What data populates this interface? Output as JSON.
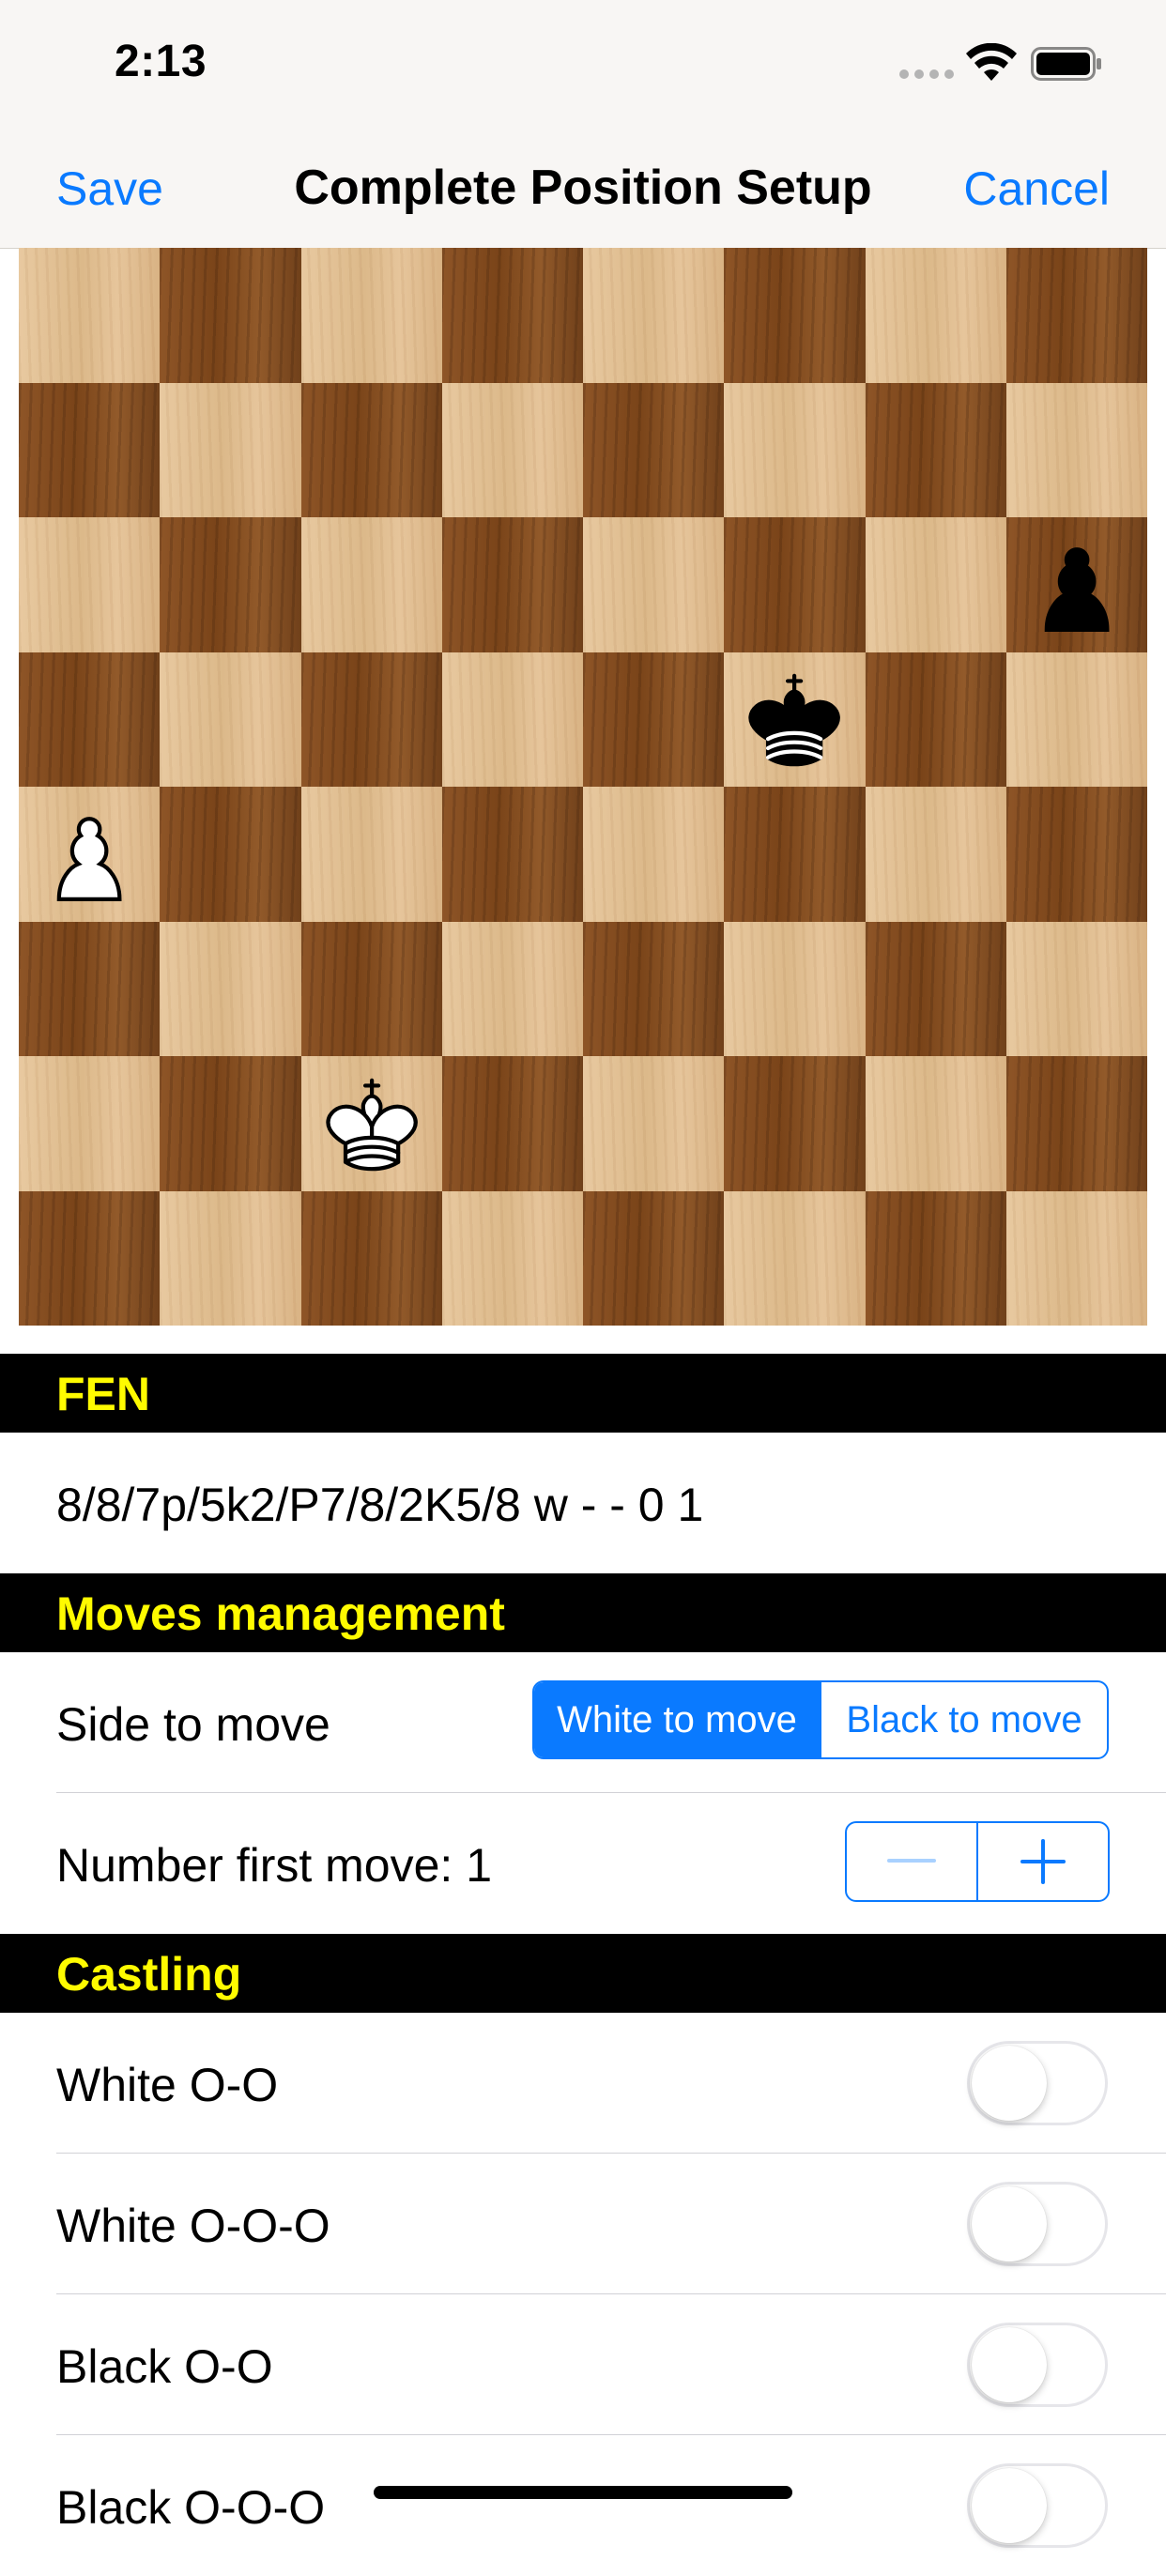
{
  "status_bar": {
    "time": "2:13"
  },
  "nav": {
    "save_label": "Save",
    "title": "Complete Position Setup",
    "cancel_label": "Cancel"
  },
  "board": {
    "pieces": [
      {
        "square": "h6",
        "color": "black",
        "type": "pawn"
      },
      {
        "square": "f5",
        "color": "black",
        "type": "king"
      },
      {
        "square": "a4",
        "color": "white",
        "type": "pawn"
      },
      {
        "square": "c2",
        "color": "white",
        "type": "king"
      }
    ]
  },
  "fen_section": {
    "header": "FEN",
    "value": "8/8/7p/5k2/P7/8/2K5/8 w - - 0 1"
  },
  "moves_section": {
    "header": "Moves management",
    "side_to_move_label": "Side to move",
    "side_options": [
      "White to move",
      "Black to move"
    ],
    "side_selected": "White to move",
    "first_move_label": "Number first move: 1",
    "stepper_minus_icon": "minus-icon",
    "stepper_plus_icon": "plus-icon"
  },
  "castling_section": {
    "header": "Castling",
    "options": [
      {
        "label": "White O-O",
        "enabled": false
      },
      {
        "label": "White O-O-O",
        "enabled": false
      },
      {
        "label": "Black O-O",
        "enabled": false
      },
      {
        "label": "Black O-O-O",
        "enabled": false
      }
    ]
  },
  "colors": {
    "accent": "#0a7aff",
    "section_header_bg": "#000000",
    "section_header_text": "#fffb00"
  }
}
